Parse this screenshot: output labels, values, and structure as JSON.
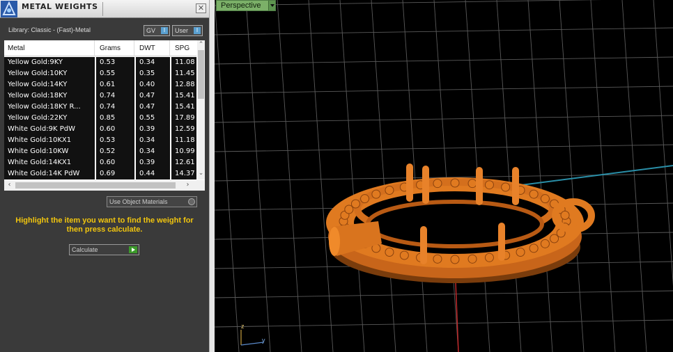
{
  "panel": {
    "title": "METAL WEIGHTS",
    "close_glyph": "✕",
    "library_label": "Library: Classic - (Fast)-Metal",
    "gv_label": "GV",
    "user_label": "User",
    "toggle_glyph": "I",
    "columns": [
      "Metal",
      "Grams",
      "DWT",
      "SPG"
    ],
    "rows": [
      [
        "Yellow Gold:9KY",
        "0.53",
        "0.34",
        "11.08"
      ],
      [
        "Yellow Gold:10KY",
        "0.55",
        "0.35",
        "11.45"
      ],
      [
        "Yellow Gold:14KY",
        "0.61",
        "0.40",
        "12.88"
      ],
      [
        "Yellow Gold:18KY",
        "0.74",
        "0.47",
        "15.41"
      ],
      [
        "Yellow Gold:18KY R...",
        "0.74",
        "0.47",
        "15.41"
      ],
      [
        "Yellow Gold:22KY",
        "0.85",
        "0.55",
        "17.89"
      ],
      [
        "White Gold:9K PdW",
        "0.60",
        "0.39",
        "12.59"
      ],
      [
        "White Gold:10KX1",
        "0.53",
        "0.34",
        "11.18"
      ],
      [
        "White Gold:10KW",
        "0.52",
        "0.34",
        "10.99"
      ],
      [
        "White Gold:14KX1",
        "0.60",
        "0.39",
        "12.61"
      ],
      [
        "White Gold:14K PdW",
        "0.69",
        "0.44",
        "14.37"
      ]
    ],
    "use_object_materials_label": "Use Object Materials",
    "hint_text": "Highlight the item you want to find the weight for then press calculate.",
    "calculate_label": "Calculate"
  },
  "viewport": {
    "view_mode": "Perspective",
    "axis_z": "z",
    "axis_y": "y",
    "background_color": "#000000",
    "grid_color": "#5a5a5a",
    "model_color": "#e07a20"
  }
}
